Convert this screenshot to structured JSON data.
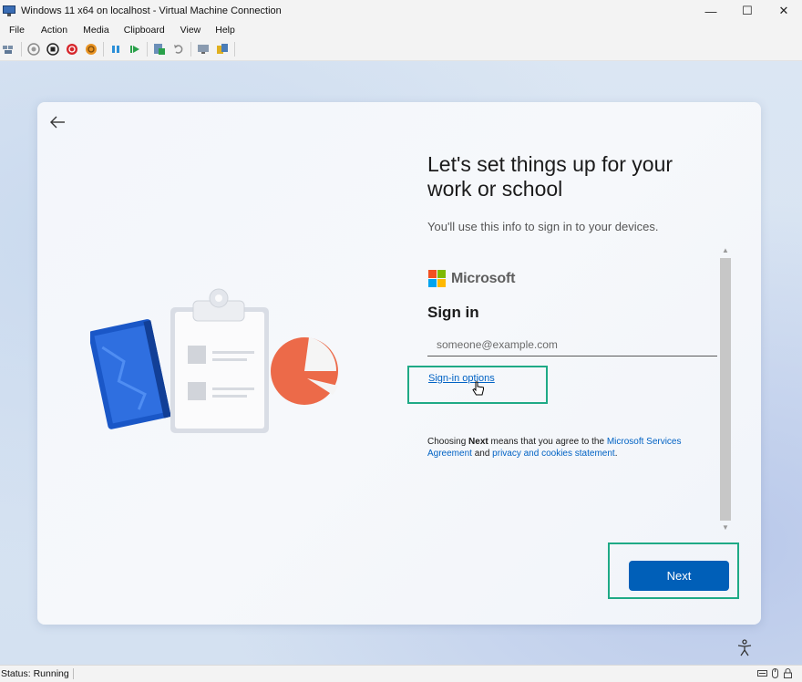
{
  "window": {
    "title": "Windows 11 x64 on localhost - Virtual Machine Connection",
    "minimize_glyph": "—",
    "maximize_glyph": "☐",
    "close_glyph": "✕"
  },
  "menu": [
    "File",
    "Action",
    "Media",
    "Clipboard",
    "View",
    "Help"
  ],
  "toolbar_icons": [
    "ctrl-alt-del-icon",
    "start-icon",
    "turn-off-icon",
    "shut-down-icon",
    "save-icon",
    "pause-icon",
    "resume-icon",
    "checkpoint-icon",
    "revert-icon",
    "enhanced-session-icon",
    "share-icon"
  ],
  "setup": {
    "heading": "Let's set things up for your work or school",
    "subtitle": "You'll use this info to sign in to your devices.",
    "brand": "Microsoft",
    "signin_title": "Sign in",
    "email_placeholder": "someone@example.com",
    "email_value": "",
    "signin_options": "Sign-in options",
    "legal": {
      "prefix": "Choosing ",
      "bold": "Next",
      "middle": " means that you agree to the ",
      "link1": "Microsoft Services Agreement",
      "and": " and ",
      "link2": "privacy and cookies statement",
      "suffix": "."
    },
    "next_label": "Next"
  },
  "statusbar": {
    "status": "Status: Running"
  },
  "colors": {
    "accent": "#005fb8",
    "link": "#0062c4",
    "highlight": "#1faa86",
    "ms_red": "#f25022",
    "ms_green": "#7fba00",
    "ms_blue": "#00a4ef",
    "ms_yellow": "#ffb900"
  }
}
